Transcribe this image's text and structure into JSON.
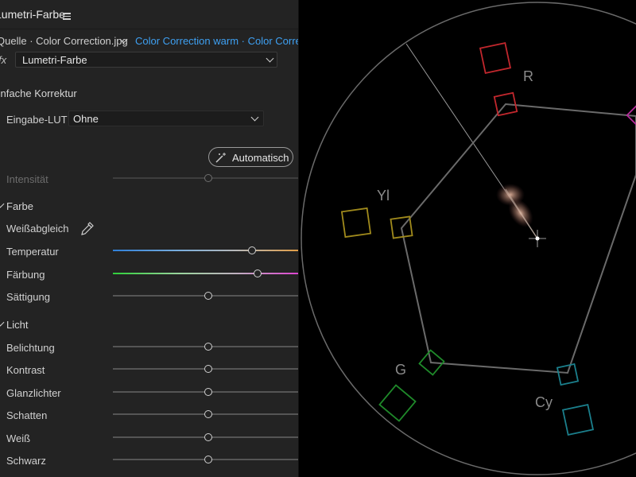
{
  "panel": {
    "title": "Lumetri-Farbe",
    "source_clip": "Quelle · Color Correction.jpg",
    "active_clip": "Color Correction warm · Color Correction",
    "fx_mark": "fx",
    "effect_name": "Lumetri-Farbe",
    "section_title": "Einfache Korrektur",
    "lut_label": "Eingabe-LUT",
    "lut_value": "Ohne",
    "auto_button": "Automatisch",
    "intensity_label": "Intensität",
    "intensity_value": 0.5
  },
  "color_group": {
    "label": "Farbe",
    "white_balance_label": "Weißabgleich",
    "temperature": {
      "label": "Temperatur",
      "value": 0.733
    },
    "tint": {
      "label": "Färbung",
      "value": 0.76
    },
    "saturation": {
      "label": "Sättigung",
      "value": 0.5
    }
  },
  "light_group": {
    "label": "Licht",
    "sliders": [
      {
        "label": "Belichtung",
        "value": 0.5
      },
      {
        "label": "Kontrast",
        "value": 0.5
      },
      {
        "label": "Glanzlichter",
        "value": 0.5
      },
      {
        "label": "Schatten",
        "value": 0.5
      },
      {
        "label": "Weiß",
        "value": 0.5
      },
      {
        "label": "Schwarz",
        "value": 0.5
      }
    ]
  },
  "vectorscope": {
    "labels": {
      "r": "R",
      "yl": "Yl",
      "g": "G",
      "cy": "Cy"
    },
    "colors": {
      "r": "#c1272d",
      "yl": "#a08a1c",
      "g": "#1f8a2a",
      "cy": "#1b7f8c",
      "mg": "#b42a9a",
      "graticule": "#6a6a6a",
      "skin_line": "#9a9a9a"
    }
  }
}
